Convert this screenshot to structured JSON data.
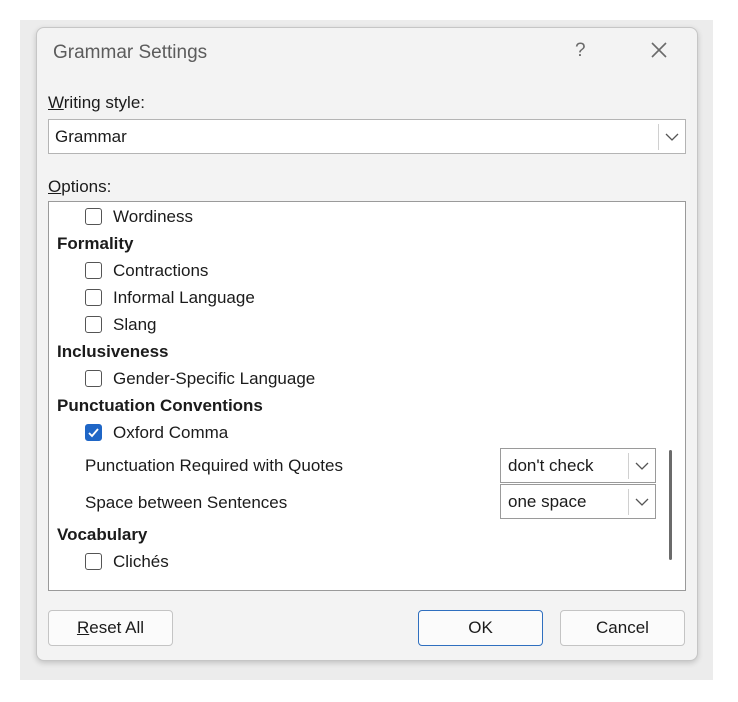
{
  "dialog": {
    "title": "Grammar Settings",
    "help": "?",
    "writing_style_label_u": "W",
    "writing_style_label_rest": "riting style:",
    "writing_style_value": "Grammar",
    "options_label_u": "O",
    "options_label_rest": "ptions:"
  },
  "options": {
    "wordiness": "Wordiness",
    "formality": "Formality",
    "contractions": "Contractions",
    "informal_language": "Informal Language",
    "slang": "Slang",
    "inclusiveness": "Inclusiveness",
    "gender_specific": "Gender-Specific Language",
    "punctuation": "Punctuation Conventions",
    "oxford_comma": "Oxford Comma",
    "punct_quotes_label": "Punctuation Required with Quotes",
    "punct_quotes_value": "don't check",
    "space_sentences_label": "Space between Sentences",
    "space_sentences_value": "one space",
    "vocabulary": "Vocabulary",
    "cliches": "Clichés"
  },
  "checked": {
    "wordiness": false,
    "contractions": false,
    "informal_language": false,
    "slang": false,
    "gender_specific": false,
    "oxford_comma": true,
    "cliches": false
  },
  "buttons": {
    "reset_u": "R",
    "reset_rest": "eset All",
    "ok": "OK",
    "cancel": "Cancel"
  },
  "colors": {
    "accent": "#1f66c6",
    "dialog_bg": "#f3f3f3"
  }
}
